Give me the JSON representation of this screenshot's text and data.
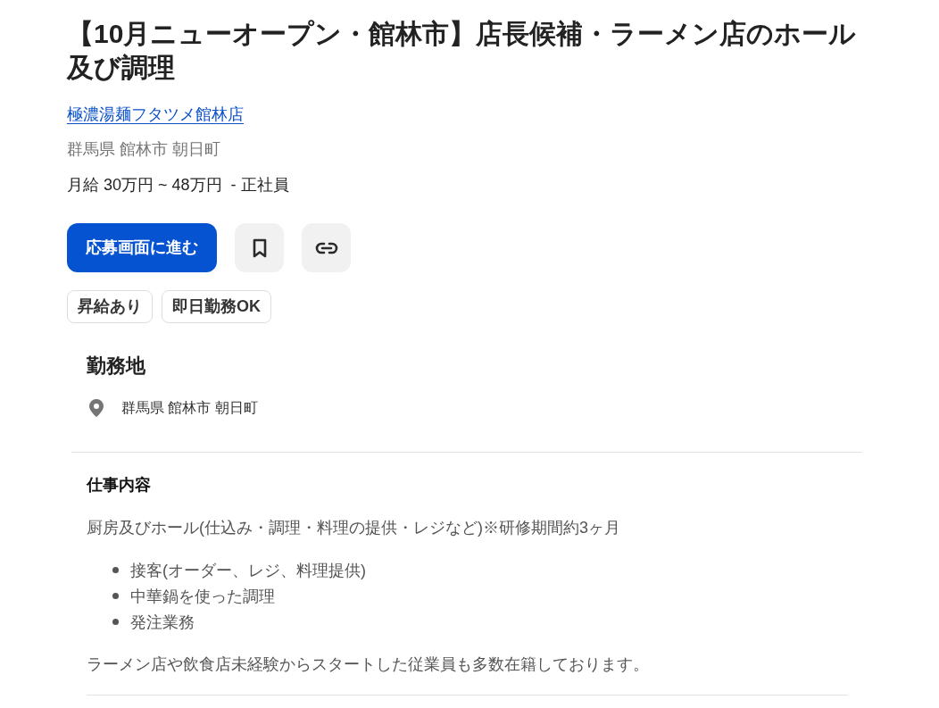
{
  "job": {
    "title": "【10月ニューオープン・館林市】店長候補・ラーメン店のホール及び調理",
    "company": "極濃湯麺フタツメ館林店",
    "location": "群馬県 館林市 朝日町",
    "salary": "月給 30万円 ~ 48万円  - 正社員"
  },
  "actions": {
    "apply_label": "応募画面に進む"
  },
  "tags": [
    "昇給あり",
    "即日勤務OK"
  ],
  "work_location": {
    "heading": "勤務地",
    "address": "群馬県 館林市 朝日町"
  },
  "job_description": {
    "heading": "仕事内容",
    "blocks": [
      {
        "kind": "paragraph",
        "text": "厨房及びホール(仕込み・調理・料理の提供・レジなど)※研修期間約3ヶ月"
      },
      {
        "kind": "list",
        "items": [
          "接客(オーダー、レジ、料理提供)",
          "中華鍋を使った調理",
          "発注業務"
        ]
      },
      {
        "kind": "paragraph",
        "text": "ラーメン店や飲食店未経験からスタートした従業員も多数在籍しております。"
      }
    ]
  }
}
